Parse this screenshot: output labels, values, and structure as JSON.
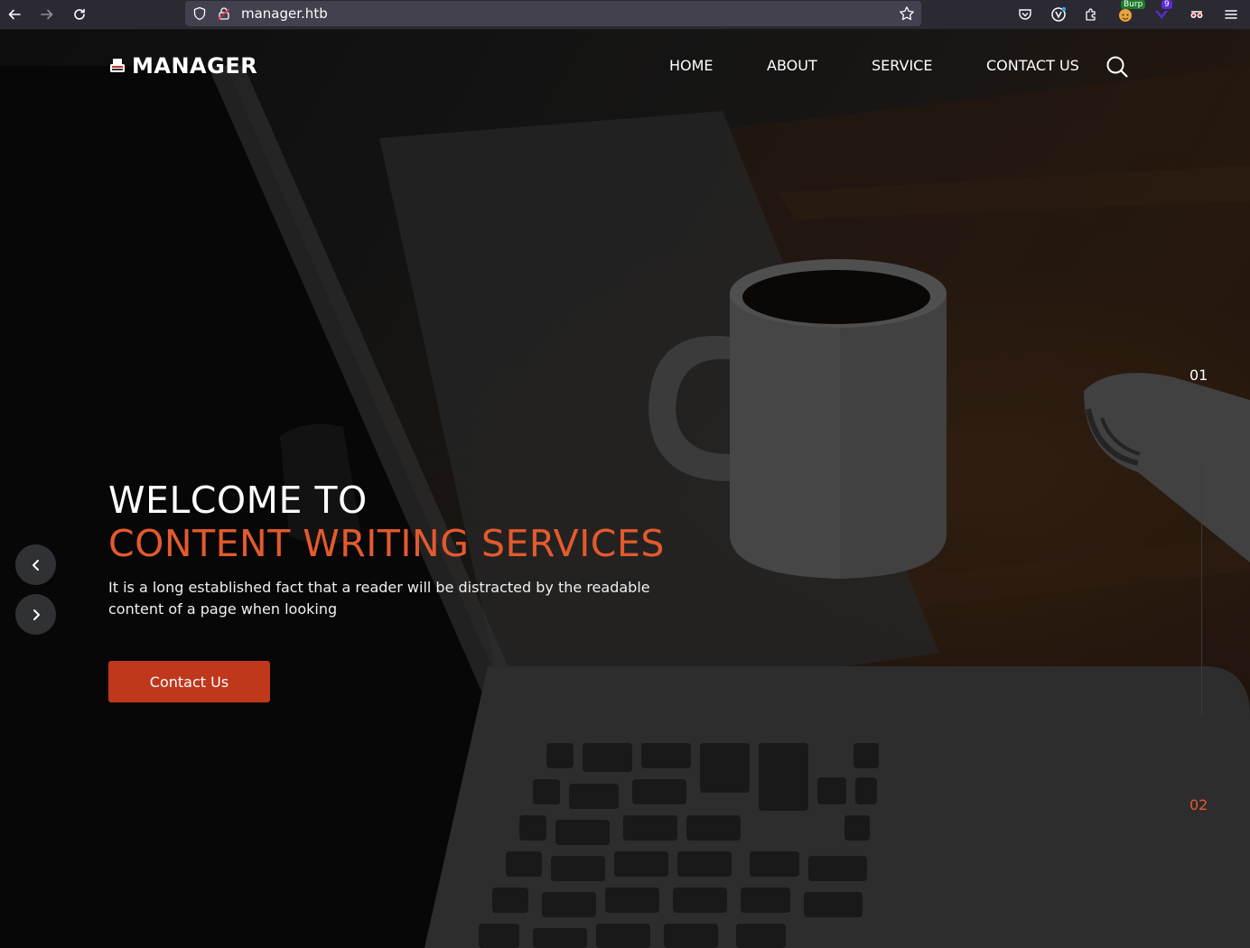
{
  "browser": {
    "url": "manager.htb",
    "extension_badges": {
      "burp": "Burp",
      "count": "9"
    }
  },
  "site": {
    "brand": "MANAGER",
    "nav": [
      {
        "label": "HOME"
      },
      {
        "label": "ABOUT"
      },
      {
        "label": "SERVICE"
      },
      {
        "label": "CONTACT US"
      }
    ]
  },
  "hero": {
    "title_line1": "WELCOME TO",
    "title_line2": "CONTENT WRITING SERVICES",
    "description": "It is a long established fact that a reader will be distracted by the readable content of a page when looking",
    "cta_label": "Contact Us",
    "slide_indicators": [
      "01",
      "02"
    ]
  },
  "colors": {
    "accent": "#e35a2e",
    "button": "#c0381c",
    "chrome": "#2b2a33"
  }
}
